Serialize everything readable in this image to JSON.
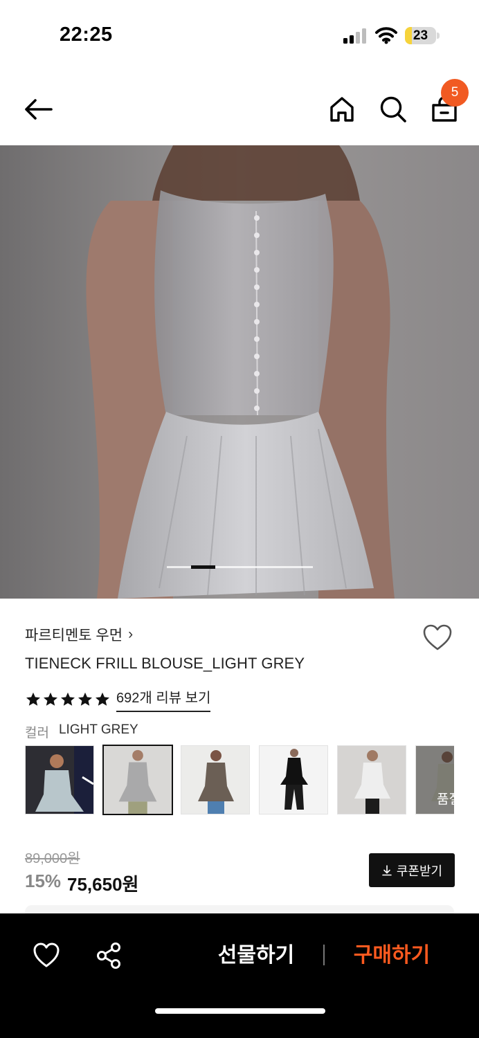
{
  "status": {
    "time": "22:25",
    "battery": "23",
    "battery_level": 0.23
  },
  "header": {
    "cart_count": "5",
    "icons": [
      "back-arrow-icon",
      "home-icon",
      "search-icon",
      "shopping-bag-icon"
    ]
  },
  "hero": {
    "slide_count": 6,
    "active_slide": 2
  },
  "product": {
    "brand": "파르티멘토 우먼",
    "brand_chevron": "›",
    "name": "TIENECK FRILL BLOUSE_LIGHT GREY",
    "rating_stars": 5,
    "review_link": "692개 리뷰 보기",
    "color_label": "컬러",
    "color_value": "LIGHT GREY",
    "thumb_overlay_text": "품절",
    "original_price": "89,000원",
    "discount": "15%",
    "sale_price": "75,650원",
    "coupon_label": "쿠폰받기"
  },
  "bottom_bar": {
    "gift_label": "선물하기",
    "buy_label": "구매하기"
  },
  "colors": {
    "accent": "#f15a22",
    "buy": "#ff5a1f",
    "star": "#111111"
  }
}
